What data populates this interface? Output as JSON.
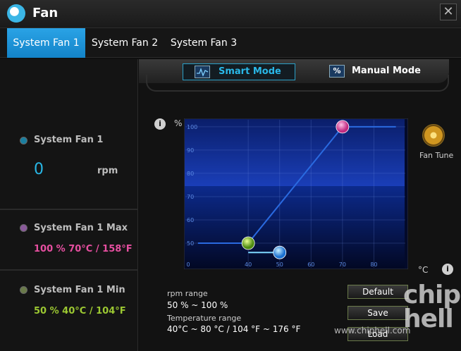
{
  "window": {
    "title": "Fan",
    "close_glyph": "✕"
  },
  "tabs": [
    {
      "label": "System Fan 1",
      "active": true
    },
    {
      "label": "System Fan 2",
      "active": false
    },
    {
      "label": "System Fan 3",
      "active": false
    }
  ],
  "left_panel": {
    "current": {
      "label": "System Fan 1",
      "value": "0",
      "unit": "rpm",
      "dot_color": "#1a7fa0"
    },
    "max": {
      "label": "System Fan 1 Max",
      "value": "100 %  70°C / 158°F",
      "dot_color": "#8a5a9a",
      "value_color": "#e64fa0"
    },
    "min": {
      "label": "System Fan 1 Min",
      "value": "50 %  40°C / 104°F",
      "dot_color": "#6a7a4a",
      "value_color": "#9cc832"
    }
  },
  "modes": {
    "smart": {
      "label": "Smart Mode",
      "icon": "waveform-icon",
      "active": true
    },
    "manual": {
      "label": "Manual Mode",
      "icon": "percent-icon",
      "icon_glyph": "%",
      "active": false
    }
  },
  "chart": {
    "y_unit": "%",
    "x_unit": "°C",
    "info_glyph": "i"
  },
  "chart_data": {
    "type": "line",
    "x_ticks": [
      "0",
      "40",
      "50",
      "60",
      "70",
      "80"
    ],
    "y_ticks": [
      "50",
      "60",
      "70",
      "80",
      "90",
      "100"
    ],
    "xlim": [
      20,
      90
    ],
    "ylim": [
      40,
      103
    ],
    "series": [
      {
        "points": [
          [
            24,
            50
          ],
          [
            40,
            50
          ],
          [
            70,
            100
          ],
          [
            87,
            100
          ]
        ],
        "color": "#2a6ae0"
      }
    ],
    "handles": [
      {
        "x": 40,
        "y": 50,
        "color": "#7cc520"
      },
      {
        "x": 70,
        "y": 100,
        "color": "#e64fa0"
      }
    ],
    "rpm_handle": {
      "x": 50,
      "y": 46,
      "color": "#2a9ae8"
    },
    "grid": true
  },
  "fan_tune": {
    "label": "Fan Tune",
    "icon": "fan-tune-icon"
  },
  "ranges": {
    "rpm_label": "rpm range",
    "rpm_value": "50 % ~ 100 %",
    "temp_label": "Temperature range",
    "temp_value": "40°C ~ 80 °C / 104 °F ~ 176 °F"
  },
  "buttons": {
    "default": "Default",
    "save": "Save",
    "load": "Load"
  },
  "watermark": {
    "logo_text": "chip hell",
    "url": "www.chiphell.com"
  }
}
